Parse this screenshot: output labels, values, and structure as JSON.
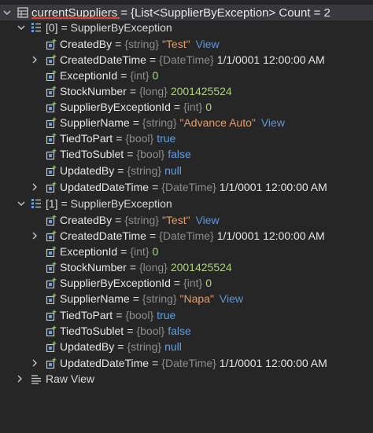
{
  "root": {
    "name": "currentSuppliers",
    "eq": "=",
    "value": "{List<SupplierByException> Count = 2"
  },
  "items": [
    {
      "label": "[0] = SupplierByException",
      "props": [
        {
          "name": "CreatedBy",
          "type": "{string}",
          "value": "\"Test\"",
          "view": "View"
        },
        {
          "name": "CreatedDateTime",
          "type": "{DateTime}",
          "value": "1/1/0001 12:00:00 AM"
        },
        {
          "name": "ExceptionId",
          "type": "{int}",
          "value": "0"
        },
        {
          "name": "StockNumber",
          "type": "{long}",
          "value": "2001425524"
        },
        {
          "name": "SupplierByExceptionId",
          "type": "{int}",
          "value": "0"
        },
        {
          "name": "SupplierName",
          "type": "{string}",
          "value": "\"Advance Auto\"",
          "view": "View"
        },
        {
          "name": "TiedToPart",
          "type": "{bool}",
          "value": "true"
        },
        {
          "name": "TiedToSublet",
          "type": "{bool}",
          "value": "false"
        },
        {
          "name": "UpdatedBy",
          "type": "{string}",
          "value": "null"
        },
        {
          "name": "UpdatedDateTime",
          "type": "{DateTime}",
          "value": "1/1/0001 12:00:00 AM"
        }
      ]
    },
    {
      "label": "[1] = SupplierByException",
      "props": [
        {
          "name": "CreatedBy",
          "type": "{string}",
          "value": "\"Test\"",
          "view": "View"
        },
        {
          "name": "CreatedDateTime",
          "type": "{DateTime}",
          "value": "1/1/0001 12:00:00 AM"
        },
        {
          "name": "ExceptionId",
          "type": "{int}",
          "value": "0"
        },
        {
          "name": "StockNumber",
          "type": "{long}",
          "value": "2001425524"
        },
        {
          "name": "SupplierByExceptionId",
          "type": "{int}",
          "value": "0"
        },
        {
          "name": "SupplierName",
          "type": "{string}",
          "value": "\"Napa\"",
          "view": "View"
        },
        {
          "name": "TiedToPart",
          "type": "{bool}",
          "value": "true"
        },
        {
          "name": "TiedToSublet",
          "type": "{bool}",
          "value": "false"
        },
        {
          "name": "UpdatedBy",
          "type": "{string}",
          "value": "null"
        },
        {
          "name": "UpdatedDateTime",
          "type": "{DateTime}",
          "value": "1/1/0001 12:00:00 AM"
        }
      ]
    }
  ],
  "raw_view": {
    "label": "Raw View"
  },
  "colors": {
    "background": "#262626",
    "selected_row": "#39393d",
    "type_gray": "#8d8d8d",
    "string_orange": "#e69c6b",
    "number_green": "#a9d47c",
    "keyword_blue": "#5fa0e6",
    "link_blue": "#5f96d6",
    "underline_red": "#e23b3b"
  },
  "icons": {
    "root": "variable-table-icon",
    "item": "list-item-icon",
    "property": "property-icon",
    "raw": "raw-view-icon"
  }
}
